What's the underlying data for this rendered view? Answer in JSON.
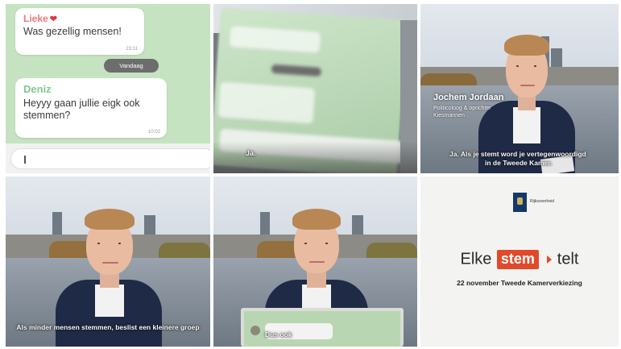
{
  "chat": {
    "message1": {
      "sender": "Lieke",
      "heart": "❤",
      "text": "Was gezellig mensen!",
      "time": "23:11"
    },
    "date_separator": "Vandaag",
    "message2": {
      "sender": "Deniz",
      "text": "Heyyy gaan jullie eigk ook stemmen?",
      "time": "10:02"
    },
    "input_placeholder": ""
  },
  "panel2": {
    "subtitle": "Ja."
  },
  "panel3": {
    "name": "Jochem Jordaan",
    "role": "Politicoloog & oprichter Kiesmannen",
    "subtitle_line1": "Ja. Als je stemt word je vertegenwoordigd",
    "subtitle_line2": "in de Tweede Kamer."
  },
  "panel4": {
    "subtitle": "Als minder mensen stemmen, beslist een kleinere groep"
  },
  "panel5": {
    "subtitle": "Dus ook"
  },
  "panel6": {
    "org": "Rijksoverheid",
    "slogan_word1": "Elke",
    "slogan_word2": "stem",
    "slogan_word3": "telt",
    "subline": "22 november Tweede Kamerverkiezing",
    "accent_color": "#e1492b"
  }
}
